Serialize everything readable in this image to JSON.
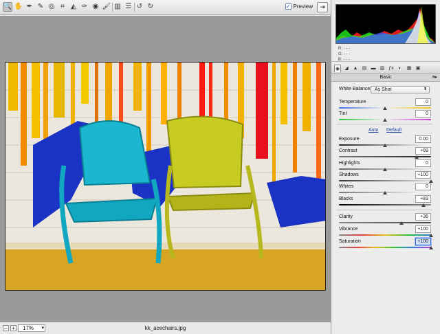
{
  "toolbar": {
    "tools": [
      {
        "name": "zoom-tool",
        "icon": "magnifier-icon",
        "glyph": "🔍"
      },
      {
        "name": "hand-tool",
        "icon": "hand-icon",
        "glyph": "✋"
      },
      {
        "name": "white-balance-tool",
        "icon": "eyedropper-icon",
        "glyph": "✒"
      },
      {
        "name": "color-sampler-tool",
        "icon": "sampler-icon",
        "glyph": "✎"
      },
      {
        "name": "targeted-adjustment-tool",
        "icon": "target-adjust-icon",
        "glyph": "◎"
      },
      {
        "name": "crop-tool",
        "icon": "crop-icon",
        "glyph": "⌗"
      },
      {
        "name": "straighten-tool",
        "icon": "straighten-icon",
        "glyph": "◭"
      },
      {
        "name": "spot-removal-tool",
        "icon": "spot-removal-icon",
        "glyph": "✑"
      },
      {
        "name": "red-eye-tool",
        "icon": "red-eye-icon",
        "glyph": "◉"
      },
      {
        "name": "adjustment-brush-tool",
        "icon": "brush-icon",
        "glyph": "🖌"
      },
      {
        "name": "graduated-filter-tool",
        "icon": "graduated-filter-icon",
        "glyph": "▥"
      },
      {
        "name": "preferences-button",
        "icon": "list-icon",
        "glyph": "☰"
      },
      {
        "name": "rotate-left-button",
        "icon": "rotate-ccw-icon",
        "glyph": "↺"
      },
      {
        "name": "rotate-right-button",
        "icon": "rotate-cw-icon",
        "glyph": "↻"
      }
    ],
    "preview_label": "Preview",
    "preview_checked": "✓",
    "fullscreen_glyph": "⇥"
  },
  "status": {
    "zoom_out": "–",
    "zoom_in": "+",
    "zoom_value": "17%",
    "zoom_arrow": "▾",
    "filename": "kk_acechairs.jpg"
  },
  "readout": {
    "r": "R:   - - -",
    "g": "G:   - - -",
    "b": "B:   - - -"
  },
  "panel": {
    "section_title": "Basic",
    "section_menu": "≡▸",
    "white_balance_label": "White Balance:",
    "white_balance_value": "As Shot",
    "auto_label": "Auto",
    "default_label": "Default",
    "sliders": {
      "temperature": {
        "label": "Temperature",
        "value": "0",
        "level": 0.5
      },
      "tint": {
        "label": "Tint",
        "value": "0",
        "level": 0.5
      },
      "exposure": {
        "label": "Exposure",
        "value": "0.00",
        "level": 0.5
      },
      "contrast": {
        "label": "Contrast",
        "value": "+69",
        "level": 0.845
      },
      "highlights": {
        "label": "Highlights",
        "value": "0",
        "level": 0.5
      },
      "shadows": {
        "label": "Shadows",
        "value": "+100",
        "level": 1.0
      },
      "whites": {
        "label": "Whites",
        "value": "0",
        "level": 0.5
      },
      "blacks": {
        "label": "Blacks",
        "value": "+83",
        "level": 0.915
      },
      "clarity": {
        "label": "Clarity",
        "value": "+36",
        "level": 0.68
      },
      "vibrance": {
        "label": "Vibrance",
        "value": "+100",
        "level": 1.0
      },
      "saturation": {
        "label": "Saturation",
        "value": "+100",
        "level": 1.0
      }
    }
  },
  "colors": {
    "accent": "#1d3ea3",
    "canvas_gray": "#9a9a9a",
    "wall": "#ece8dc",
    "chair_cyan": "#19b7cf",
    "chair_yellow": "#c9cb1f",
    "shadow_blue": "#1b33c4"
  }
}
